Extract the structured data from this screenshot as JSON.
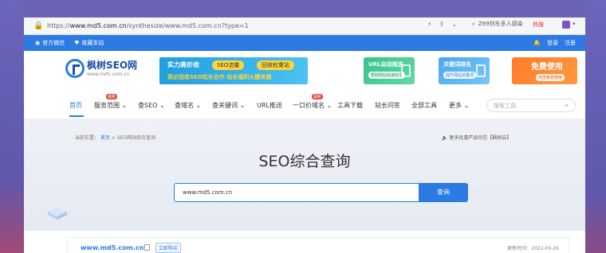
{
  "browser": {
    "url_prefix": "https://",
    "url_domain": "www.md5.com.cn",
    "url_path": "/synthesize/www.md5.com.cn?type=1",
    "search_text": "Z69列车多人感染",
    "hot_label": "热搜"
  },
  "topbar": {
    "wechat": "官方微信",
    "bookmark": "收藏本站",
    "login": "登录",
    "register": "注册"
  },
  "header": {
    "logo_name": "枫树SEO网",
    "logo_site": "www.md5.com.cn",
    "ad1_title": "实力高价收",
    "ad1_pill1": "SEO流量",
    "ad1_pill2": "回收权重站",
    "ad1_sub": "高价回收SEO站长合作 站长福利火爆来袭",
    "ad2_title": "URL自动推送",
    "ad2_btn": "帮助网站快速收录",
    "ad3_title": "关键词排名",
    "ad3_btn": "提升网站关键词",
    "ad4_title": "免费使用",
    "ad4_btn": "点击免费使用"
  },
  "nav": {
    "items": [
      "首页",
      "服务范围",
      "查SEO",
      "查域名",
      "查关键词",
      "URL推送",
      "一口价域名",
      "工具下载",
      "站长问答",
      "全部工具",
      "更多"
    ],
    "badge1": "最新",
    "badge2": "最新",
    "search_placeholder": "搜索工具"
  },
  "banner": {
    "crumb_label": "当前位置：",
    "crumb_home": "首页",
    "crumb_sep": ">",
    "crumb_current": "SEO网站综合查询",
    "promo": "更多优惠产品尽在【枫树云】",
    "title": "SEO综合查询",
    "input_value": "www.md5.com.cn",
    "button": "查询"
  },
  "result": {
    "domain": "www.md5.com.cn",
    "buy": "立即购买",
    "updated": "更新时间：2022-09-26"
  }
}
